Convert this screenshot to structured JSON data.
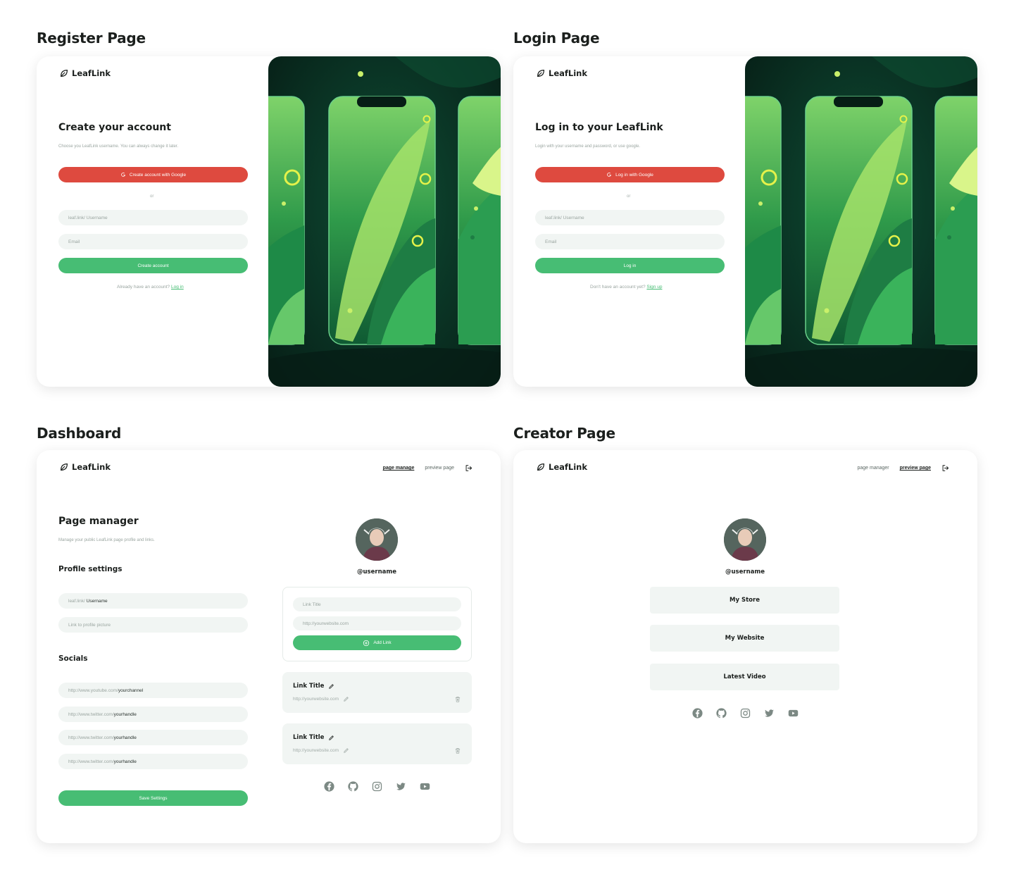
{
  "sections": {
    "register": "Register Page",
    "login": "Login Page",
    "dashboard": "Dashboard",
    "creator": "Creator Page"
  },
  "brand": "LeafLink",
  "icons": {
    "logo": "leaf-icon",
    "google": "google-icon",
    "logout": "logout-icon",
    "edit": "pencil-icon",
    "delete": "trash-icon",
    "add": "plus-circle-icon",
    "socials": [
      "facebook-icon",
      "github-icon",
      "instagram-icon",
      "twitter-icon",
      "youtube-icon"
    ]
  },
  "colors": {
    "accent_green": "#47bd74",
    "google_red": "#de4a3f",
    "field_bg": "#f1f5f3"
  },
  "register": {
    "title": "Create your account",
    "subtitle": "Choose you LeafLink username.  You can always change it later.",
    "google_button": "Create account with Google",
    "or": "or",
    "username_placeholder": "leaf.link/ Username",
    "email_placeholder": "Email",
    "submit": "Create account",
    "footer_text": "Already have an account?",
    "footer_link": "Log in"
  },
  "login": {
    "title": "Log in to your LeafLink",
    "subtitle": "Login with your username and password, or  use google.",
    "google_button": "Log in with Google",
    "or": "or",
    "username_placeholder": "leaf.link/ Username",
    "email_placeholder": "Email",
    "submit": "Log in",
    "footer_text": "Don't have an account yet?",
    "footer_link": "Sign up"
  },
  "nav": {
    "page_manager_active": "page manage",
    "page_manager": "page manager",
    "preview": "preview page"
  },
  "dashboard": {
    "title": "Page manager",
    "subtitle": "Manage your public LeafLink page profile and links.",
    "profile_heading": "Profile settings",
    "username_prefix": "leaf.link/",
    "username_value": "Username",
    "picture_placeholder": "Link to profile picture",
    "socials_heading": "Socials",
    "socials": [
      {
        "prefix": "http://www.youtube.com/",
        "value": "yourchannel"
      },
      {
        "prefix": "http://www.twitter.com/",
        "value": "yourhandle"
      },
      {
        "prefix": "http://www.twitter.com/",
        "value": "yourhandle"
      },
      {
        "prefix": "http://www.twitter.com/",
        "value": "yourhandle"
      }
    ],
    "save": "Save Settings",
    "username_display": "@username",
    "new_link": {
      "title_placeholder": "Link Title",
      "url_placeholder": "http://yourwebsite.com",
      "add_button": "Add Link"
    },
    "links": [
      {
        "title": "Link Title",
        "url": "http://yourwebsite.com"
      },
      {
        "title": "Link Title",
        "url": "http://yourwebsite.com"
      }
    ]
  },
  "creator": {
    "username_display": "@username",
    "links": [
      "My Store",
      "My Website",
      "Latest Video"
    ]
  }
}
